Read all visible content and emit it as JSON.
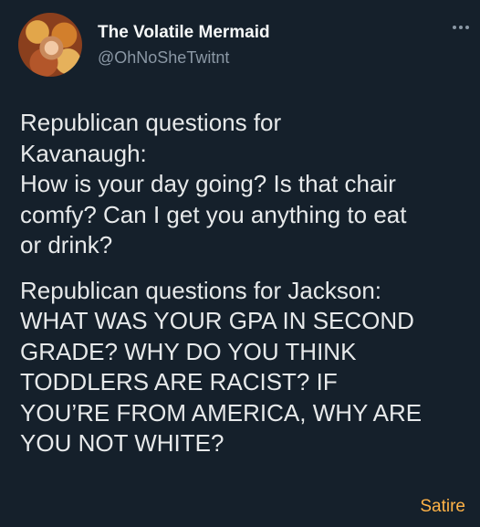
{
  "author": {
    "display_name": "The Volatile Mermaid",
    "handle": "@OhNoSheTwitnt"
  },
  "tweet": {
    "paragraph_1": "Republican questions for\nKavanaugh:\nHow is your day going? Is that chair\ncomfy? Can I get you anything to eat\nor drink?",
    "paragraph_2": "Republican questions for Jackson:\nWHAT WAS YOUR GPA IN SECOND\nGRADE? WHY DO YOU THINK\nTODDLERS ARE RACIST? IF\nYOU’RE FROM AMERICA, WHY ARE\nYOU NOT WHITE?"
  },
  "tag": "Satire",
  "colors": {
    "background": "#15202b",
    "text": "#e7e9ea",
    "secondary": "#8b98a5",
    "tag": "#ffb347"
  }
}
